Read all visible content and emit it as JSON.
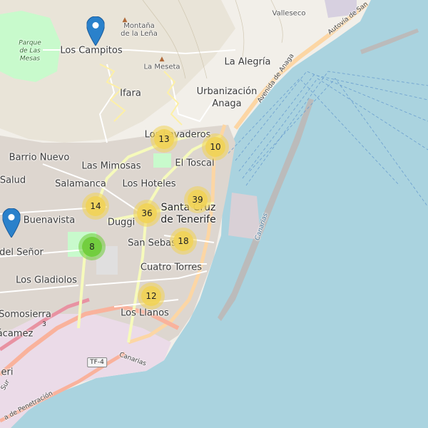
{
  "map": {
    "places": [
      {
        "id": "valleseco",
        "text": "Valleseco"
      },
      {
        "id": "los-campitos",
        "text": "Los Campitos"
      },
      {
        "id": "montana",
        "text": "Montaña\nde la Leña"
      },
      {
        "id": "la-meseta",
        "text": "La Meseta"
      },
      {
        "id": "la-alegria",
        "text": "La Alegría"
      },
      {
        "id": "ifara",
        "text": "Ifara"
      },
      {
        "id": "urbanizacion",
        "text": "Urbanización\nAnaga"
      },
      {
        "id": "los-lavaderos",
        "text": "Los Lavaderos"
      },
      {
        "id": "barrio-nuevo",
        "text": "Barrio Nuevo"
      },
      {
        "id": "las-mimosas",
        "text": "Las Mimosas"
      },
      {
        "id": "el-toscal",
        "text": "El Toscal"
      },
      {
        "id": "salud",
        "text": "Salud"
      },
      {
        "id": "salamanca",
        "text": "Salamanca"
      },
      {
        "id": "los-hoteles",
        "text": "Los Hoteles"
      },
      {
        "id": "buenavista",
        "text": "Buenavista"
      },
      {
        "id": "duggi",
        "text": "Duggi"
      },
      {
        "id": "santa-cruz",
        "text": "Santa Cruz\nde Tenerife"
      },
      {
        "id": "san-sebastian",
        "text": "San Sebas"
      },
      {
        "id": "del-senor",
        "text": "del Señor"
      },
      {
        "id": "cuatro-torres",
        "text": "Cuatro Torres"
      },
      {
        "id": "los-gladiolos",
        "text": "Los Gladiolos"
      },
      {
        "id": "somosierra",
        "text": "Somosierra"
      },
      {
        "id": "los-llanos",
        "text": "Los Llanos"
      },
      {
        "id": "camez",
        "text": "ácamez"
      },
      {
        "id": "eri",
        "text": "eri"
      },
      {
        "id": "parque",
        "text": "Parque\nde Las\nMesas"
      }
    ],
    "roads": [
      {
        "id": "avenida-anaga",
        "text": "Avenida de Anaga"
      },
      {
        "id": "autovia",
        "text": "Autovía de San"
      },
      {
        "id": "canarias-1",
        "text": "Canarias"
      },
      {
        "id": "canarias-2",
        "text": "Canarias"
      },
      {
        "id": "penetracion",
        "text": "a de Penetración"
      },
      {
        "id": "sur",
        "text": "Sur"
      }
    ],
    "shields": [
      {
        "id": "tf4",
        "text": "TF-4"
      },
      {
        "id": "tf3",
        "text": "3"
      }
    ],
    "clusters": [
      {
        "id": "c13",
        "count": "13",
        "color": "#f1d357"
      },
      {
        "id": "c10",
        "count": "10",
        "color": "#f1d357"
      },
      {
        "id": "c39",
        "count": "39",
        "color": "#f1d357"
      },
      {
        "id": "c14",
        "count": "14",
        "color": "#f1d357"
      },
      {
        "id": "c36",
        "count": "36",
        "color": "#f1d357"
      },
      {
        "id": "c18",
        "count": "18",
        "color": "#f1d357"
      },
      {
        "id": "c8",
        "count": "8",
        "color": "#6ecc39"
      },
      {
        "id": "c12",
        "count": "12",
        "color": "#f1d357"
      }
    ],
    "markers": [
      {
        "id": "marker-los-campitos",
        "color": "#2a81cb"
      },
      {
        "id": "marker-buenavista",
        "color": "#2a81cb"
      }
    ],
    "colors": {
      "sea": "#aad3df",
      "land": "#f2efe9",
      "park": "#c8facc",
      "motorway": "#e892a2",
      "primary": "#fcd6a4",
      "trunk": "#f9b29c"
    }
  }
}
